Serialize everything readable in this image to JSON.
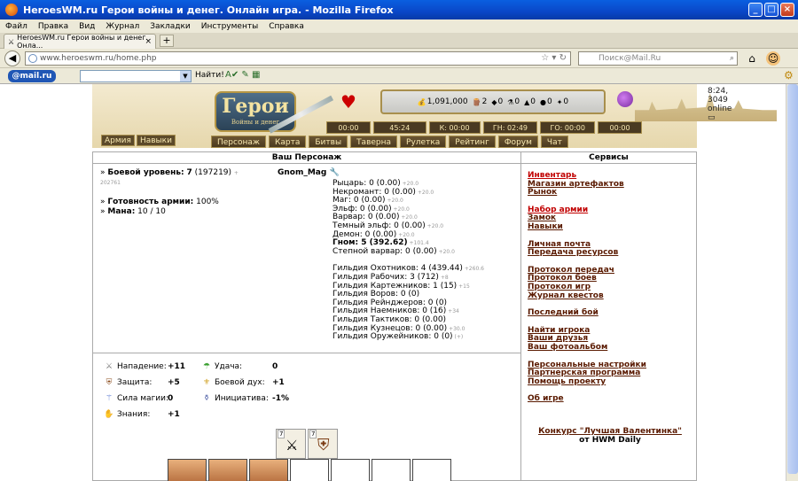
{
  "window": {
    "title": "HeroesWM.ru Герои войны и денег. Онлайн игра. - Mozilla Firefox"
  },
  "menu": [
    "Файл",
    "Правка",
    "Вид",
    "Журнал",
    "Закладки",
    "Инструменты",
    "Справка"
  ],
  "tab": {
    "label": "HeroesWM.ru Герои войны и денег. Онла...",
    "close": "×",
    "new": "+"
  },
  "url": "www.heroeswm.ru/home.php",
  "search": {
    "placeholder": "Поиск@Mail.Ru"
  },
  "mailbar": {
    "logo": "@mail.ru",
    "find": "Найти!"
  },
  "header": {
    "logo": "Герои",
    "logo_sub": "Войны и денег",
    "online": "8:24, 3049 online",
    "resources": [
      "1,091,000",
      "2",
      "0",
      "0",
      "0",
      "0",
      "0"
    ],
    "timers": [
      "00:00",
      "45:24",
      "К: 00:00",
      "ГН: 02:49",
      "ГО: 00:00",
      "00:00"
    ],
    "left_buttons": [
      "Армия",
      "Навыки"
    ],
    "nav": [
      "Персонаж",
      "Карта",
      "Битвы",
      "Таверна",
      "Рулетка",
      "Рейтинг",
      "Форум",
      "Чат"
    ]
  },
  "panels": {
    "character": "Ваш Персонаж",
    "services": "Сервисы"
  },
  "character": {
    "name": "Gnom_Mag",
    "level_label": "Боевой уровень:",
    "level": "7",
    "level_exp": "(197219)",
    "level_next": "+ 202761",
    "readiness_label": "Готовность армии:",
    "readiness": "100%",
    "mana_label": "Мана:",
    "mana": "10 / 10"
  },
  "factions": [
    {
      "text": "Рыцарь: 0 (0.00)",
      "plus": "+20.0"
    },
    {
      "text": "Некромант: 0 (0.00)",
      "plus": "+20.0"
    },
    {
      "text": "Маг: 0 (0.00)",
      "plus": "+20.0"
    },
    {
      "text": "Эльф: 0 (0.00)",
      "plus": "+20.0"
    },
    {
      "text": "Варвар: 0 (0.00)",
      "plus": "+20.0"
    },
    {
      "text": "Темный эльф: 0 (0.00)",
      "plus": "+20.0"
    },
    {
      "text": "Демон: 0 (0.00)",
      "plus": "+20.0"
    },
    {
      "text": "Гном: 5 (392.62)",
      "plus": "+101.4"
    },
    {
      "text": "Степной варвар: 0 (0.00)",
      "plus": "+20.0"
    }
  ],
  "guilds": [
    {
      "text": "Гильдия Охотников: 4 (439.44)",
      "plus": "+260.6"
    },
    {
      "text": "Гильдия Рабочих: 3 (712)",
      "plus": "+8"
    },
    {
      "text": "Гильдия Картежников: 1 (15)",
      "plus": "+15"
    },
    {
      "text": "Гильдия Воров: 0 (0)",
      "plus": ""
    },
    {
      "text": "Гильдия Рейнджеров: 0 (0)",
      "plus": ""
    },
    {
      "text": "Гильдия Наемников: 0 (16)",
      "plus": "+34"
    },
    {
      "text": "Гильдия Тактиков: 0 (0.00)",
      "plus": ""
    },
    {
      "text": "Гильдия Кузнецов: 0 (0.00)",
      "plus": "+30.0"
    },
    {
      "text": "Гильдия Оружейников: 0 (0)",
      "plus": "(+)"
    }
  ],
  "services": [
    [
      "Инвентарь",
      "Магазин артефактов",
      "Рынок"
    ],
    [
      "Набор армии",
      "Замок",
      "Навыки"
    ],
    [
      "Личная почта",
      "Передача ресурсов"
    ],
    [
      "Протокол передач",
      "Протокол боев",
      "Протокол игр",
      "Журнал квестов"
    ],
    [
      "Последний бой"
    ],
    [
      "Найти игрока",
      "Ваши друзья",
      "Ваш фотоальбом"
    ],
    [
      "Персональные настройки",
      "Партнерская программа",
      "Помощь проекту"
    ],
    [
      "Об игре"
    ]
  ],
  "contest": {
    "title": "Конкурс \"Лучшая Валентинка\"",
    "sub": "от HWM Daily"
  },
  "stats": [
    {
      "label": "Нападение:",
      "value": "+11",
      "icon": "swords-icon"
    },
    {
      "label": "Защита:",
      "value": "+5",
      "icon": "shield-icon"
    },
    {
      "label": "Сила магии:",
      "value": "0",
      "icon": "wand-icon"
    },
    {
      "label": "Знания:",
      "value": "+1",
      "icon": "book-icon"
    },
    {
      "label": "Удача:",
      "value": "0",
      "icon": "rainbow-icon"
    },
    {
      "label": "Боевой дух:",
      "value": "+1",
      "icon": "wings-icon"
    },
    {
      "label": "Инициатива:",
      "value": "-1%",
      "icon": "bottle-icon"
    }
  ],
  "slots": [
    "7",
    "7"
  ]
}
